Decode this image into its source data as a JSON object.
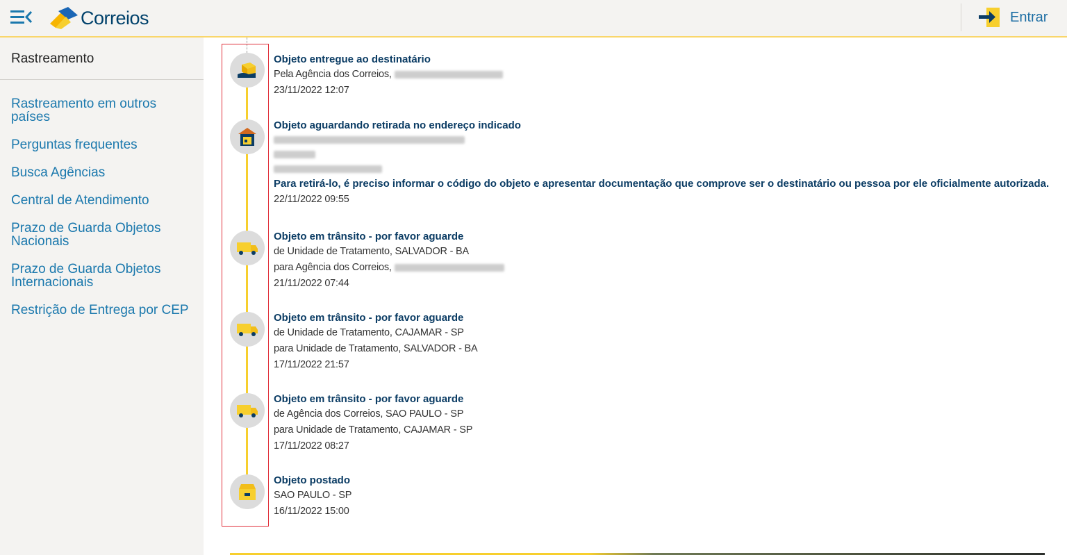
{
  "header": {
    "brand": "Correios",
    "login_label": "Entrar",
    "icons": {
      "menu": "menu-collapse-icon",
      "logo": "correios-logo",
      "login": "login-arrow-icon"
    }
  },
  "colors": {
    "brand_blue": "#00416b",
    "link_blue": "#1a78ad",
    "accent_yellow": "#f7cf2e",
    "highlight_red": "#e0303a"
  },
  "sidebar": {
    "title": "Rastreamento",
    "items": [
      {
        "label": "Rastreamento em outros países"
      },
      {
        "label": "Perguntas frequentes"
      },
      {
        "label": "Busca Agências"
      },
      {
        "label": "Central de Atendimento"
      },
      {
        "label": "Prazo de Guarda Objetos Nacionais"
      },
      {
        "label": "Prazo de Guarda Objetos Internacionais"
      },
      {
        "label": "Restrição de Entrega por CEP"
      }
    ]
  },
  "events": [
    {
      "icon": "hand-package-icon",
      "title": "Objeto entregue ao destinatário",
      "line1": "Pela Agência dos Correios,",
      "datetime": "23/11/2022 12:07"
    },
    {
      "icon": "pickup-point-icon",
      "title": "Objeto aguardando retirada no endereço indicado",
      "note": "Para retirá-lo, é preciso informar o código do objeto e apresentar documentação que comprove ser o destinatário ou pessoa por ele oficialmente autorizada.",
      "datetime": "22/11/2022 09:55"
    },
    {
      "icon": "truck-icon",
      "title": "Objeto em trânsito - por favor aguarde",
      "line1": "de Unidade de Tratamento, SALVADOR - BA",
      "line2": "para Agência dos Correios,",
      "datetime": "21/11/2022 07:44"
    },
    {
      "icon": "truck-icon",
      "title": "Objeto em trânsito - por favor aguarde",
      "line1": "de Unidade de Tratamento, CAJAMAR - SP",
      "line2": "para Unidade de Tratamento, SALVADOR - BA",
      "datetime": "17/11/2022 21:57"
    },
    {
      "icon": "truck-icon",
      "title": "Objeto em trânsito - por favor aguarde",
      "line1": "de Agência dos Correios, SAO PAULO - SP",
      "line2": "para Unidade de Tratamento, CAJAMAR - SP",
      "datetime": "17/11/2022 08:27"
    },
    {
      "icon": "posted-box-icon",
      "title": "Objeto postado",
      "line1": "SAO PAULO - SP",
      "datetime": "16/11/2022 15:00"
    }
  ]
}
